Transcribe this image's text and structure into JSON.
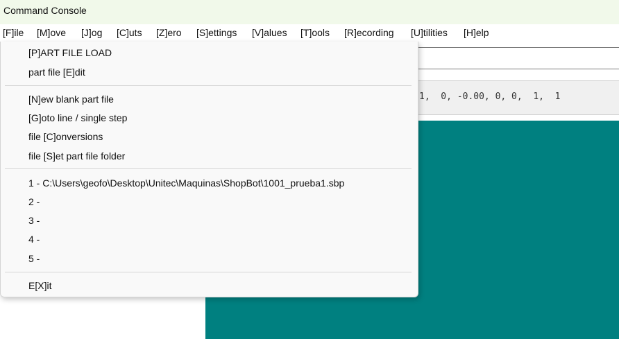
{
  "window": {
    "title": "Command Console"
  },
  "menubar": {
    "items": [
      {
        "label": "[F]ile"
      },
      {
        "label": "[M]ove"
      },
      {
        "label": "[J]og"
      },
      {
        "label": "[C]uts"
      },
      {
        "label": "[Z]ero"
      },
      {
        "label": "[S]ettings"
      },
      {
        "label": "[V]alues"
      },
      {
        "label": "[T]ools"
      },
      {
        "label": "[R]ecording"
      },
      {
        "label": "[U]tilities"
      },
      {
        "label": "[H]elp"
      }
    ]
  },
  "file_menu": {
    "items": [
      {
        "label": "[P]ART FILE LOAD"
      },
      {
        "label": "part file [E]dit"
      },
      {
        "label": "[N]ew blank part file"
      },
      {
        "label": "[G]oto line / single step"
      },
      {
        "label": "file [C]onversions"
      },
      {
        "label": "file [S]et part file folder"
      },
      {
        "label": "1 - C:\\Users\\geofo\\Desktop\\Unitec\\Maquinas\\ShopBot\\1001_prueba1.sbp"
      },
      {
        "label": "2 -"
      },
      {
        "label": "3 -"
      },
      {
        "label": "4 -"
      },
      {
        "label": "5 -"
      },
      {
        "label": "E[X]it"
      }
    ]
  },
  "console": {
    "status_text": "1,  0, -0.00, 0, 0,  1,  1"
  },
  "colors": {
    "titlebar": "#f1f9ea",
    "panel": "#008080",
    "menu_bg": "#f9f9f9"
  }
}
